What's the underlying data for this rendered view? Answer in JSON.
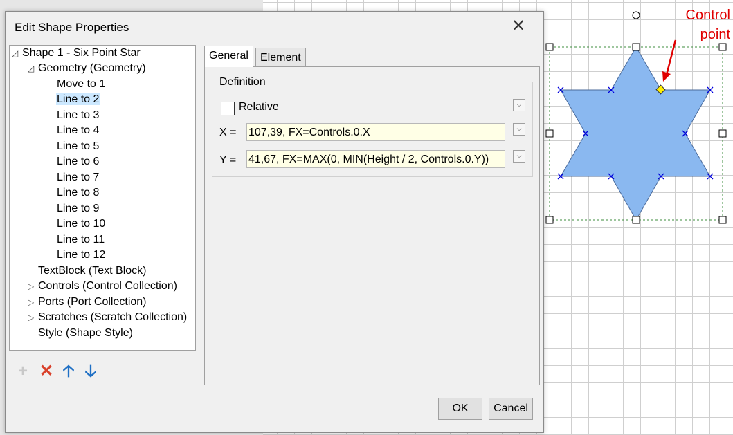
{
  "window": {
    "title": "Edit Shape Properties",
    "close_glyph": "✕"
  },
  "tree": {
    "root": "Shape 1 - Six Point Star",
    "geometry": "Geometry (Geometry)",
    "path_items": [
      "Move to 1",
      "Line to 2",
      "Line to 3",
      "Line to 4",
      "Line to 5",
      "Line to 6",
      "Line to 7",
      "Line to 8",
      "Line to 9",
      "Line to 10",
      "Line to 11",
      "Line to 12"
    ],
    "selected_item": "Line to 2",
    "textblock": "TextBlock (Text Block)",
    "controls": "Controls (Control Collection)",
    "ports": "Ports (Port Collection)",
    "scratches": "Scratches (Scratch Collection)",
    "style": "Style (Shape Style)",
    "expanded_glyph": "◿",
    "collapsed_glyph": "▷"
  },
  "tree_tools": [
    {
      "name": "add",
      "glyph": "+",
      "color": "#c8c8c8"
    },
    {
      "name": "delete",
      "glyph": "✕",
      "color": "#d9402a"
    },
    {
      "name": "move-up",
      "glyph": "🡡",
      "color": "#1e6fc4"
    },
    {
      "name": "move-down",
      "glyph": "🡣",
      "color": "#1e6fc4"
    }
  ],
  "tabs": {
    "general": "General",
    "element": "Element",
    "active": "General"
  },
  "definition": {
    "legend": "Definition",
    "relative_label": "Relative",
    "relative_checked": false,
    "x_label": "X =",
    "x_value": "107,39, FX=Controls.0.X",
    "y_label": "Y =",
    "y_value": "41,67, FX=MAX(0, MIN(Height / 2, Controls.0.Y))"
  },
  "buttons": {
    "ok": "OK",
    "cancel": "Cancel"
  },
  "annotation": {
    "line1": "Control",
    "line2": "point",
    "color": "#e00000"
  },
  "colors": {
    "star_fill": "#8ab8f0",
    "star_stroke": "#4a6a9a",
    "vertex_marker": "#0000dd",
    "control_point": "#ffee00",
    "selection_box": "#3c8c3c"
  }
}
